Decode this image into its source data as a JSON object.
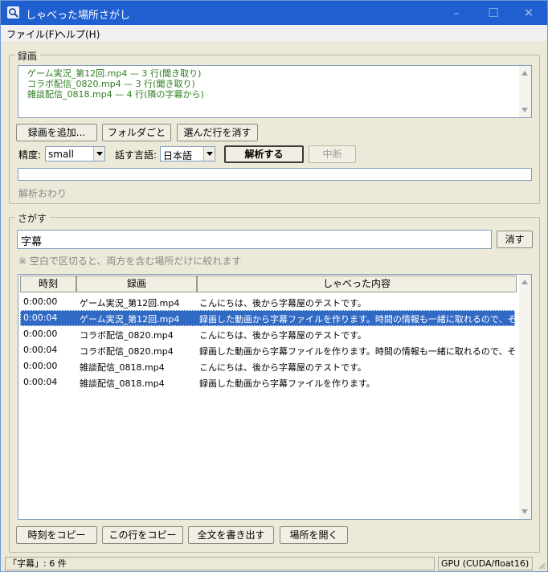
{
  "window": {
    "title": "しゃべった場所さがし"
  },
  "menu": {
    "file": "ファイル(F)",
    "help": "ヘルプ(H)"
  },
  "recordings": {
    "group_title": "録画",
    "log": [
      "ゲーム実況_第12回.mp4  — 3 行(聞き取り)",
      "コラボ配信_0820.mp4  — 3 行(聞き取り)",
      "雑談配信_0818.mp4  — 4 行(隣の字幕から)"
    ],
    "buttons": {
      "add": "録画を追加...",
      "folder": "フォルダごと",
      "remove": "選んだ行を消す"
    },
    "precision_label": "精度:",
    "precision_value": "small",
    "language_label": "話す言語:",
    "language_value": "日本語",
    "analyze_button": "解析する",
    "stop_button": "中断",
    "progress_fraction": 0,
    "status_text": "解析おわり"
  },
  "search": {
    "group_title": "さがす",
    "query": "字幕",
    "clear_button": "消す",
    "hint": "※ 空白で区切ると、両方を含む場所だけに絞れます",
    "columns": {
      "time": "時刻",
      "recording": "録画",
      "speech": "しゃべった内容"
    },
    "rows": [
      {
        "time": "0:00:00",
        "recording": "ゲーム実況_第12回.mp4",
        "speech": "こんにちは、後から字幕屋のテストです。",
        "selected": false
      },
      {
        "time": "0:00:04",
        "recording": "ゲーム実況_第12回.mp4",
        "speech": "録画した動画から字幕ファイルを作ります。時間の情報も一緒に取れるので、そのまま",
        "selected": true
      },
      {
        "time": "0:00:00",
        "recording": "コラボ配信_0820.mp4",
        "speech": "こんにちは、後から字幕屋のテストです。",
        "selected": false
      },
      {
        "time": "0:00:04",
        "recording": "コラボ配信_0820.mp4",
        "speech": "録画した動画から字幕ファイルを作ります。時間の情報も一緒に取れるので、そのまま",
        "selected": false
      },
      {
        "time": "0:00:00",
        "recording": "雑談配信_0818.mp4",
        "speech": "こんにちは、後から字幕屋のテストです。",
        "selected": false
      },
      {
        "time": "0:00:04",
        "recording": "雑談配信_0818.mp4",
        "speech": "録画した動画から字幕ファイルを作ります。",
        "selected": false
      }
    ],
    "actions": {
      "copy_time": "時刻をコピー",
      "copy_row": "この行をコピー",
      "export": "全文を書き出す",
      "open": "場所を開く"
    }
  },
  "statusbar": {
    "left": "「字幕」: 6 件",
    "right": "GPU (CUDA/float16)"
  }
}
